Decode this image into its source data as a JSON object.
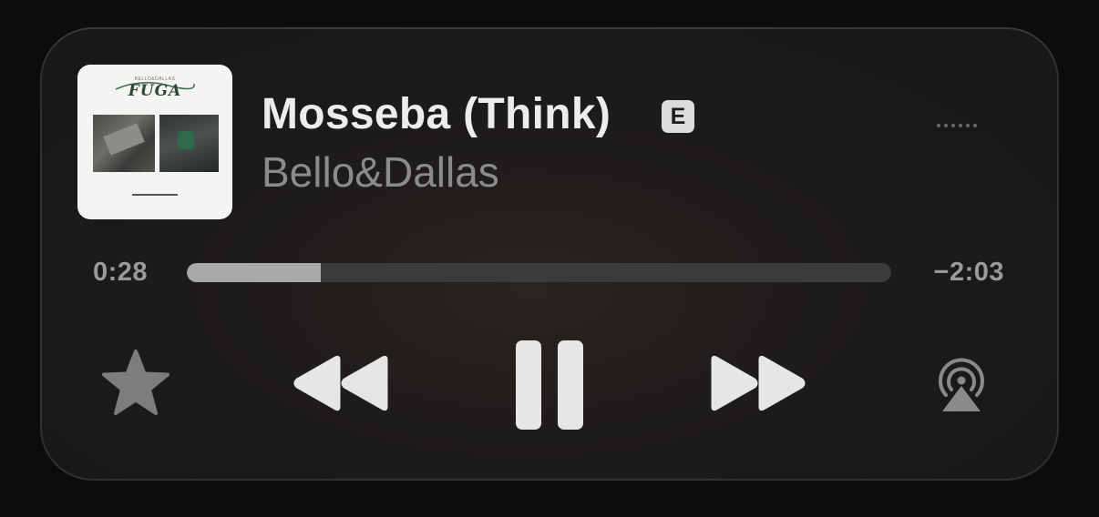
{
  "track": {
    "title": "Mosseba (Think)",
    "explicit_label": "E",
    "artist": "Bello&Dallas"
  },
  "album_art": {
    "subtitle": "BELLO&DALLAS",
    "title": "FUGA"
  },
  "playback": {
    "elapsed": "0:28",
    "remaining": "−2:03",
    "progress_fraction": 0.19
  },
  "controls": {
    "favorite_icon": "star-icon",
    "rewind_icon": "rewind-icon",
    "pause_icon": "pause-icon",
    "forward_icon": "fast-forward-icon",
    "airplay_icon": "airplay-icon",
    "more_icon": "ellipsis-icon"
  },
  "colors": {
    "panel": "#1c1b1b",
    "primary_text": "#ececec",
    "secondary_text": "#8b8b8b",
    "progress_fill": "#a9a9ab",
    "progress_track": "#3b3b3b"
  }
}
